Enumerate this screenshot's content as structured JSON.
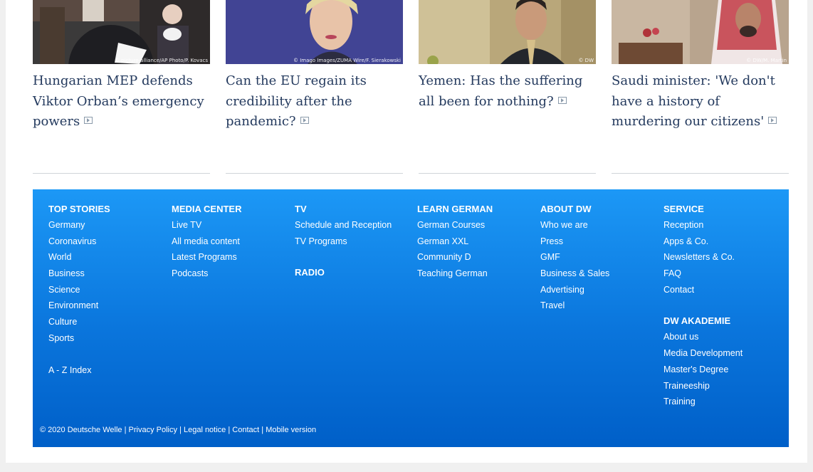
{
  "articles": [
    {
      "headline": "Hungarian MEP defends Viktor Orban’s emergency powers",
      "credit": "© picture-alliance/AP Photo/P. Kovacs"
    },
    {
      "headline": "Can the EU regain its credibility after the pandemic?",
      "credit": "© Imago Images/ZUMA Wire/F. Sierakowski"
    },
    {
      "headline": "Yemen: Has the suffering all been for nothing?",
      "credit": "© DW"
    },
    {
      "headline": "Saudi minister: 'We don't have a history of murdering our citizens'",
      "credit": "© DW/M. Martin"
    }
  ],
  "footer": {
    "top_stories": {
      "title": "TOP STORIES",
      "links": [
        "Germany",
        "Coronavirus",
        "World",
        "Business",
        "Science",
        "Environment",
        "Culture",
        "Sports"
      ],
      "az_index": "A - Z Index"
    },
    "media_center": {
      "title": "MEDIA CENTER",
      "links": [
        "Live TV",
        "All media content",
        "Latest Programs",
        "Podcasts"
      ]
    },
    "tv": {
      "title": "TV",
      "links": [
        "Schedule and Reception",
        "TV Programs"
      ],
      "radio_title": "RADIO"
    },
    "learn_german": {
      "title": "LEARN GERMAN",
      "links": [
        "German Courses",
        "German XXL",
        "Community D",
        "Teaching German"
      ]
    },
    "about_dw": {
      "title": "ABOUT DW",
      "links": [
        "Who we are",
        "Press",
        "GMF",
        "Business & Sales",
        "Advertising",
        "Travel"
      ]
    },
    "service": {
      "title": "SERVICE",
      "links": [
        "Reception",
        "Apps & Co.",
        "Newsletters & Co.",
        "FAQ",
        "Contact"
      ],
      "akademie_title": "DW AKADEMIE",
      "akademie_links": [
        "About us",
        "Media Development",
        "Master's Degree",
        "Traineeship",
        "Training"
      ]
    },
    "copyright": "© 2020 Deutsche Welle",
    "legal_links": [
      "Privacy Policy",
      "Legal notice",
      "Contact",
      "Mobile version"
    ],
    "separator": "|"
  },
  "colors": {
    "headline": "#243a5e",
    "footer_top": "#1c98f6",
    "footer_bottom": "#005fc8"
  }
}
